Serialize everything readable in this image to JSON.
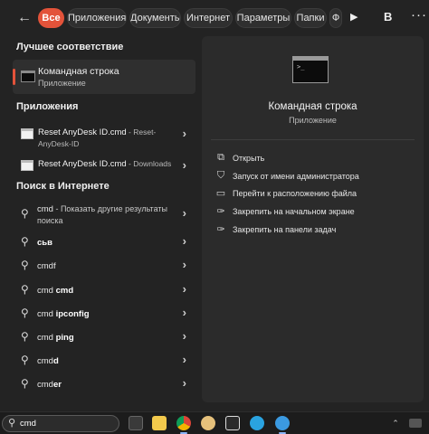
{
  "chips": [
    "Все",
    "Приложения",
    "Документы",
    "Интернет",
    "Параметры",
    "Папки",
    "Ф"
  ],
  "top_user_letter": "В",
  "sections": {
    "best_match": "Лучшее соответствие",
    "apps": "Приложения",
    "web": "Поиск в Интернете"
  },
  "best": {
    "title": "Командная строка",
    "subtitle": "Приложение"
  },
  "apps": [
    {
      "name": "Reset AnyDesk ID.cmd",
      "detail": " - Reset-",
      "detail2": "AnyDesk-ID"
    },
    {
      "name": "Reset AnyDesk ID.cmd",
      "detail": " - Downloads",
      "detail2": ""
    }
  ],
  "web": [
    {
      "prefix": "cmd",
      "bold": "",
      "suffix": " - Показать другие результаты",
      "line2": "поиска"
    },
    {
      "prefix": "",
      "bold": "сьв",
      "suffix": "",
      "line2": ""
    },
    {
      "prefix": "cmdf",
      "bold": "",
      "suffix": "",
      "line2": ""
    },
    {
      "prefix": "cmd ",
      "bold": "cmd",
      "suffix": "",
      "line2": ""
    },
    {
      "prefix": "cmd ",
      "bold": "ipconfig",
      "suffix": "",
      "line2": ""
    },
    {
      "prefix": "cmd ",
      "bold": "ping",
      "suffix": "",
      "line2": ""
    },
    {
      "prefix": "cmd",
      "bold": "d",
      "suffix": "",
      "line2": ""
    },
    {
      "prefix": "cmd",
      "bold": "er",
      "suffix": "",
      "line2": ""
    }
  ],
  "preview": {
    "title": "Командная строка",
    "subtitle": "Приложение",
    "actions": [
      {
        "icon": "open-icon",
        "label": "Открыть"
      },
      {
        "icon": "shield-icon",
        "label": "Запуск от имени администратора"
      },
      {
        "icon": "folder-icon",
        "label": "Перейти к расположению файла"
      },
      {
        "icon": "pin-icon",
        "label": "Закрепить на начальном экране"
      },
      {
        "icon": "pin-icon",
        "label": "Закрепить на панели задач"
      }
    ]
  },
  "taskbar": {
    "search_value": "cmd"
  }
}
